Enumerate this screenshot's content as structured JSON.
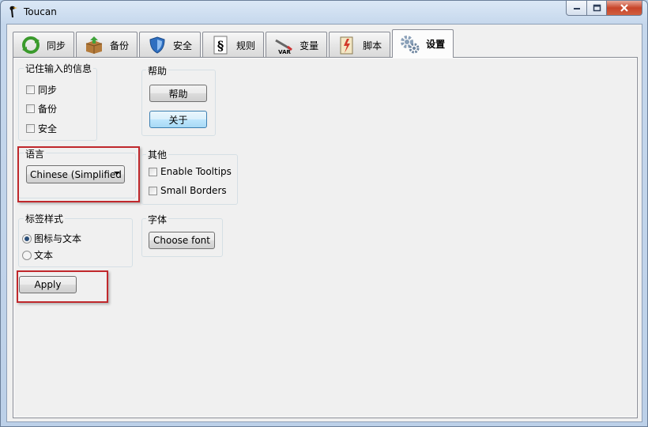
{
  "window": {
    "title": "Toucan"
  },
  "tabs": [
    {
      "label": "同步",
      "icon": "sync-icon"
    },
    {
      "label": "备份",
      "icon": "backup-icon"
    },
    {
      "label": "安全",
      "icon": "secure-icon"
    },
    {
      "label": "规则",
      "icon": "rules-icon"
    },
    {
      "label": "变量",
      "icon": "variables-icon"
    },
    {
      "label": "脚本",
      "icon": "script-icon"
    },
    {
      "label": "设置",
      "icon": "settings-icon",
      "active": true
    }
  ],
  "remember": {
    "title": "记住输入的信息",
    "items": [
      {
        "label": "同步",
        "checked": false
      },
      {
        "label": "备份",
        "checked": false
      },
      {
        "label": "安全",
        "checked": false
      }
    ]
  },
  "help": {
    "title": "帮助",
    "help_button": "帮助",
    "about_button": "关于"
  },
  "language": {
    "title": "语言",
    "selected": "Chinese (Simplified"
  },
  "other": {
    "title": "其他",
    "items": [
      {
        "label": "Enable Tooltips",
        "checked": false
      },
      {
        "label": "Small Borders",
        "checked": false
      }
    ]
  },
  "tab_style": {
    "title": "标签样式",
    "options": [
      {
        "label": "图标与文本",
        "selected": true
      },
      {
        "label": "文本",
        "selected": false
      }
    ]
  },
  "font": {
    "title": "字体",
    "button": "Choose font"
  },
  "apply_button": "Apply",
  "colors": {
    "highlight": "#c0282c",
    "window_frame": "#b9d1ea"
  }
}
